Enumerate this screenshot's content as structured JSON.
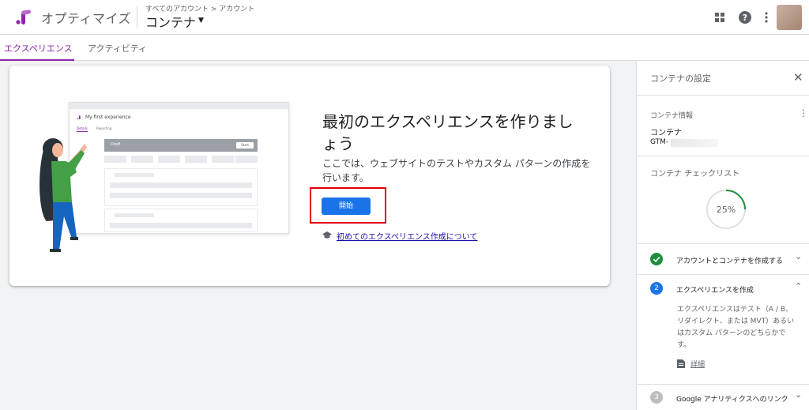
{
  "header": {
    "app_name": "オプティマイズ",
    "breadcrumb": "すべてのアカウント > アカウント",
    "container_name": "コンテナ",
    "icons": [
      "apps-grid-icon",
      "help-icon",
      "more-vert-icon",
      "avatar"
    ]
  },
  "tabs": [
    {
      "label": "エクスペリエンス",
      "active": true
    },
    {
      "label": "アクティビティ",
      "active": false
    }
  ],
  "main": {
    "title": "最初のエクスペリエンスを作りましょう",
    "description": "ここでは、ウェブサイトのテストやカスタム パターンの作成を行います。",
    "start_button": "開始",
    "help_link": "初めてのエクスペリエンス作成について",
    "mockup": {
      "title": "My first experience",
      "tabs": [
        "Details",
        "Reporting"
      ],
      "draft_label": "Draft",
      "start_label": "Start"
    }
  },
  "panel": {
    "title": "コンテナの設定",
    "info_label": "コンテナ情報",
    "container_label": "コンテナ",
    "container_id": "GTM-",
    "checklist_label": "コンテナ チェックリスト",
    "progress_text": "25%",
    "progress_value": 0.25,
    "steps": [
      {
        "number": "",
        "label": "アカウントとコンテナを作成する",
        "status": "done",
        "chevron": "⌄"
      },
      {
        "number": "2",
        "label": "エクスペリエンスを作成",
        "status": "current",
        "chevron": "⌃",
        "body": "エクスペリエンスはテスト（A / B、リダイレクト、または MVT）あるいはカスタム パターンのどちらかです。",
        "link": "詳細"
      },
      {
        "number": "3",
        "label": "Google アナリティクスへのリンク",
        "status": "pending",
        "chevron": "⌄"
      }
    ]
  },
  "colors": {
    "accent": "#8e24aa",
    "primary_button": "#1a73e8",
    "success": "#1e8e3e",
    "highlight_box": "#e3000f"
  }
}
